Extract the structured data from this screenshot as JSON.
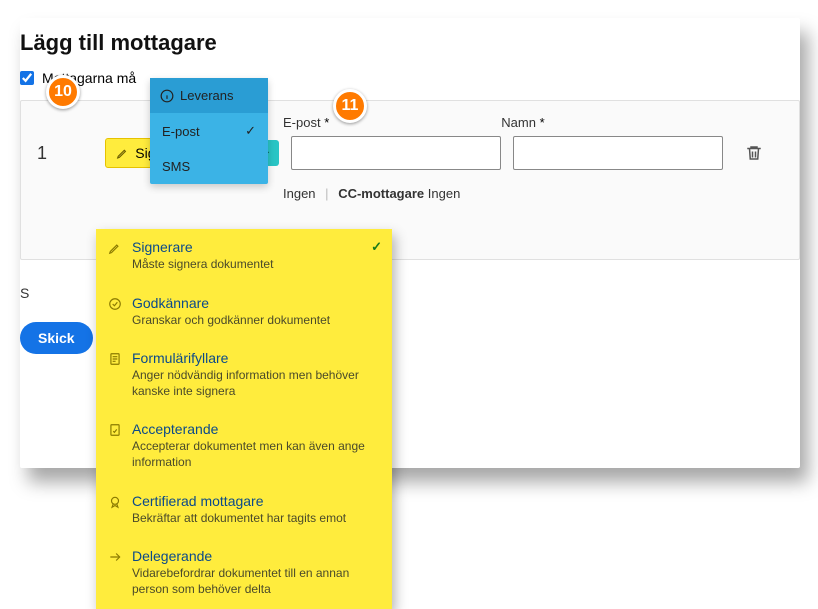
{
  "heading": "Lägg till mottagare",
  "checkbox_label": "Mottagarna må",
  "callouts": {
    "c10": "10",
    "c11": "11"
  },
  "labels": {
    "email": "E-post",
    "name": "Namn",
    "required": "*"
  },
  "row": {
    "index": "1"
  },
  "role_selected": "Signerare",
  "delivery": {
    "header": "Leverans",
    "options": [
      {
        "label": "E-post",
        "selected": true
      },
      {
        "label": "SMS",
        "selected": false
      }
    ]
  },
  "roles": [
    {
      "title": "Signerare",
      "desc": "Måste signera dokumentet",
      "selected": true
    },
    {
      "title": "Godkännare",
      "desc": "Granskar och godkänner dokumentet",
      "selected": false
    },
    {
      "title": "Formulärifyllare",
      "desc": "Anger nödvändig information men behöver kanske inte signera",
      "selected": false
    },
    {
      "title": "Accepterande",
      "desc": "Accepterar dokumentet men kan även ange information",
      "selected": false
    },
    {
      "title": "Certifierad mottagare",
      "desc": "Bekräftar att dokumentet har tagits emot",
      "selected": false
    },
    {
      "title": "Delegerande",
      "desc": "Vidarebefordrar dokumentet till en annan person som behöver delta",
      "selected": false
    }
  ],
  "cc_row": {
    "ingen": "Ingen",
    "ingen2": "Ingen",
    "cc_label": "CC-mottagare"
  },
  "add_row_partial": "S",
  "send_btn": "Skick"
}
